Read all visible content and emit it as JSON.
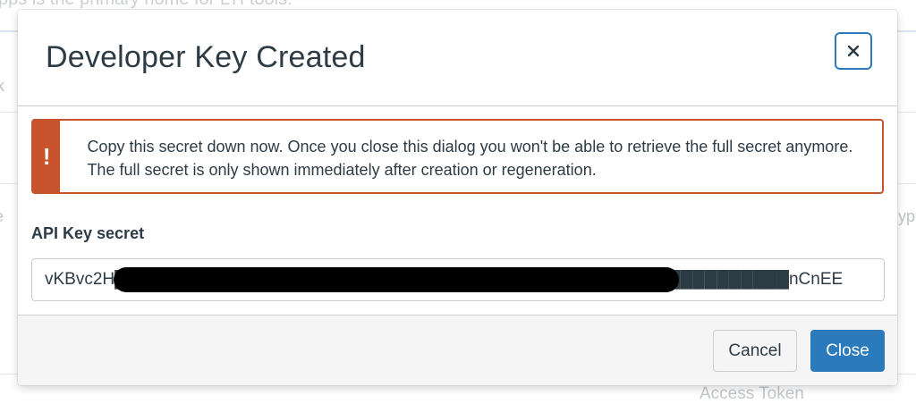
{
  "background": {
    "top_text": "pps is the primary home for LTI tools.",
    "left_fragment_1": "k",
    "left_fragment_2": "e",
    "right_fragment": "ype",
    "bottom_text": "Access Token"
  },
  "modal": {
    "title": "Developer Key Created",
    "close_icon": "close-icon",
    "alert": {
      "icon": "!",
      "message": "Copy this secret down now. Once you close this dialog you won't be able to retrieve the full secret anymore. The full secret is only shown immediately after creation or regeneration.",
      "color": "#c8532c"
    },
    "field_label": "API Key secret",
    "secret_value": "vKBvc2H████████████████████████████████████████████████████████nCnEE",
    "secret_visible_start": "vKBvc2H",
    "secret_visible_end": "nCnEE",
    "buttons": {
      "cancel": "Cancel",
      "close": "Close"
    },
    "accent_color": "#2b7abc"
  }
}
